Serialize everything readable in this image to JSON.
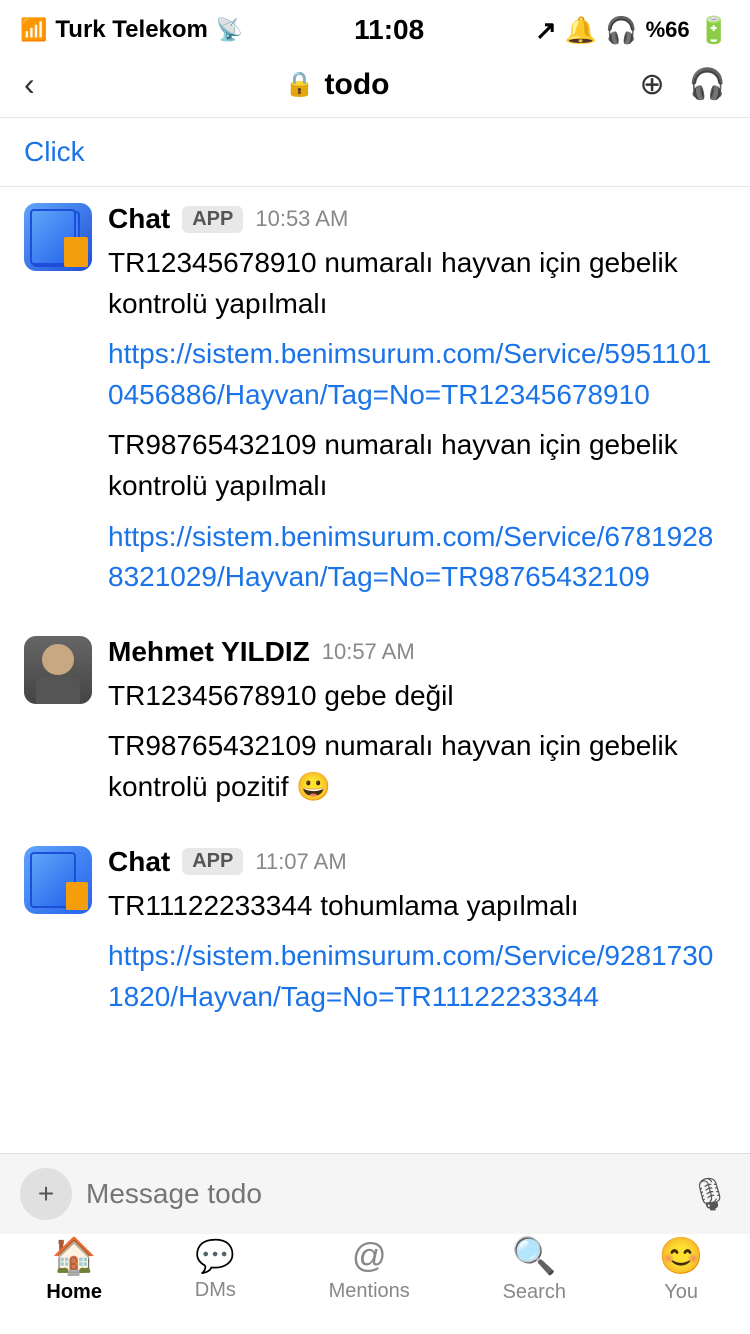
{
  "statusBar": {
    "carrier": "Turk Telekom",
    "time": "11:08",
    "battery": "%66"
  },
  "navBar": {
    "title": "todo",
    "backLabel": "‹"
  },
  "chat": {
    "clickLink": "Click",
    "messages": [
      {
        "id": "msg1",
        "sender": "Chat",
        "badge": "APP",
        "time": "10:53 AM",
        "avatarType": "app",
        "lines": [
          {
            "type": "text",
            "content": "TR12345678910 numaralı hayvan için gebelik kontrolü yapılmalı"
          },
          {
            "type": "link",
            "content": "https://sistem.benimsurum.com/Service/59511010456886/Hayvan/Tag=No=TR12345678910"
          },
          {
            "type": "text",
            "content": "TR98765432109 numaralı hayvan için gebelik kontrolü yapılmalı"
          },
          {
            "type": "link",
            "content": "https://sistem.benimsurum.com/Service/67819288321029/Hayvan/Tag=No=TR98765432109"
          }
        ]
      },
      {
        "id": "msg2",
        "sender": "Mehmet YILDIZ",
        "badge": "",
        "time": "10:57 AM",
        "avatarType": "human",
        "lines": [
          {
            "type": "text",
            "content": "TR12345678910 gebe değil"
          },
          {
            "type": "text",
            "content": "TR98765432109 numaralı hayvan için gebelik kontrolü pozitif 😀"
          }
        ]
      },
      {
        "id": "msg3",
        "sender": "Chat",
        "badge": "APP",
        "time": "11:07 AM",
        "avatarType": "app",
        "lines": [
          {
            "type": "text",
            "content": "TR11122233344 tohumlama yapılmalı"
          },
          {
            "type": "link",
            "content": "https://sistem.benimsurum.com/Service/92817301820/Hayvan/Tag=No=TR11122233344"
          }
        ]
      }
    ]
  },
  "inputArea": {
    "placeholder": "Message todo"
  },
  "bottomNav": {
    "items": [
      {
        "id": "home",
        "label": "Home",
        "icon": "🏠",
        "active": true
      },
      {
        "id": "dms",
        "label": "DMs",
        "icon": "💬",
        "active": false
      },
      {
        "id": "mentions",
        "label": "Mentions",
        "icon": "@",
        "active": false
      },
      {
        "id": "search",
        "label": "Search",
        "icon": "🔍",
        "active": false
      },
      {
        "id": "you",
        "label": "You",
        "icon": "😊",
        "active": false
      }
    ]
  }
}
